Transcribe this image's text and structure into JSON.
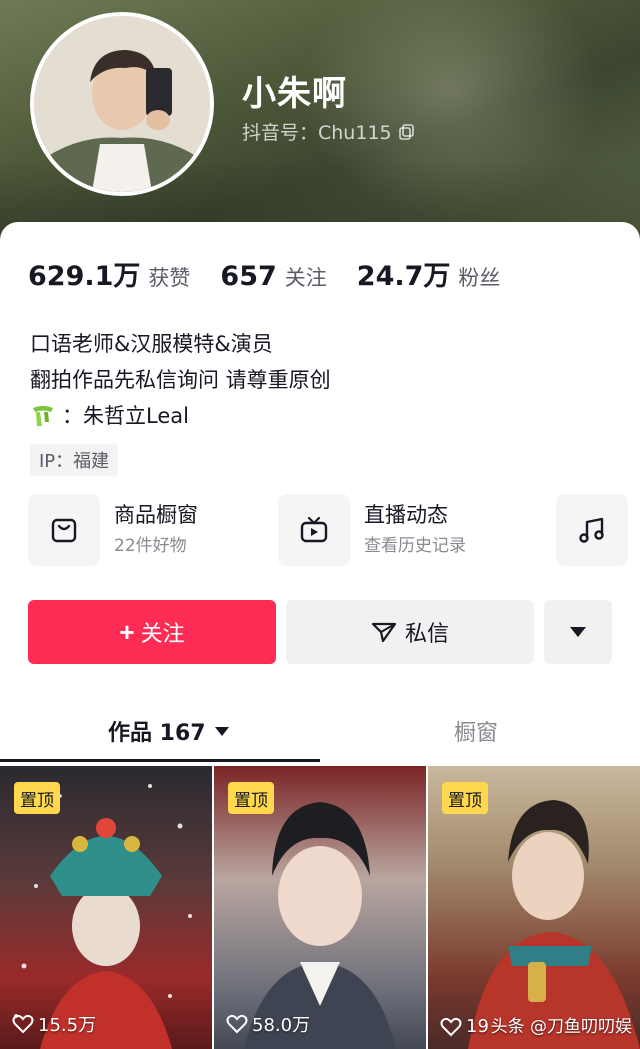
{
  "profile": {
    "nickname": "小朱啊",
    "douyin_id": "抖音号：Chu115"
  },
  "stats": [
    {
      "value": "629.1万",
      "label": "获赞"
    },
    {
      "value": "657",
      "label": "关注"
    },
    {
      "value": "24.7万",
      "label": "粉丝"
    }
  ],
  "bio": {
    "line1": "口语老师&汉服模特&演员",
    "line2": "翻拍作品先私信询问 请尊重原创",
    "line3": "：朱哲立Leal"
  },
  "ip": "IP：福建",
  "features": [
    {
      "title": "商品橱窗",
      "subtitle": "22件好物",
      "icon": "shopping-bag-icon"
    },
    {
      "title": "直播动态",
      "subtitle": "查看历史记录",
      "icon": "tv-icon"
    },
    {
      "title": "",
      "subtitle": "",
      "icon": "music-note-icon"
    }
  ],
  "actions": {
    "follow": "+ 关注",
    "follow_text": "关注",
    "message": "私信"
  },
  "tabs": {
    "works": "作品 167",
    "shop": "橱窗"
  },
  "videos": [
    {
      "badge": "置顶",
      "likes": "15.5万"
    },
    {
      "badge": "置顶",
      "likes": "58.0万"
    },
    {
      "badge": "置顶",
      "likes": "19"
    }
  ],
  "watermark": "头条 @刀鱼叨叨娱",
  "colors": {
    "accent": "#fe2c55",
    "pin_badge": "#ffd84d",
    "text_primary": "#161823",
    "text_secondary": "#8a8b91"
  }
}
